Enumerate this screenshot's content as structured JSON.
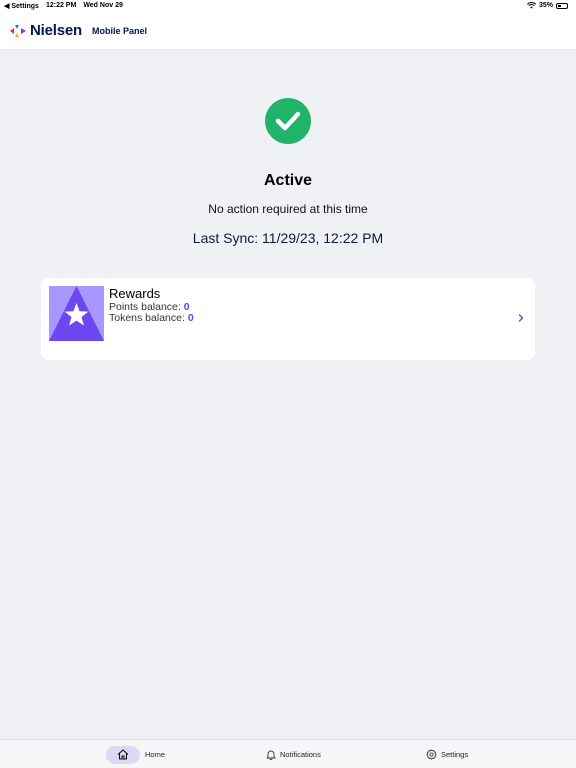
{
  "status_bar": {
    "back_app": "◀ Settings",
    "time": "12:22 PM",
    "date": "Wed Nov 29",
    "battery": "35%",
    "battery_level": 0.35
  },
  "header": {
    "brand": "Nielsen",
    "title": "Mobile Panel"
  },
  "status": {
    "icon": "checkmark-icon",
    "title": "Active",
    "description": "No action required at this time",
    "last_sync": "Last Sync: 11/29/23, 12:22 PM",
    "color": "#20b36a"
  },
  "rewards": {
    "title": "Rewards",
    "points_label": "Points balance:",
    "points_value": "0",
    "tokens_label": "Tokens balance:",
    "tokens_value": "0",
    "accent": "#6b3cf0"
  },
  "tabs": [
    {
      "label": "Home",
      "icon": "home-icon",
      "active": true
    },
    {
      "label": "Notifications",
      "icon": "bell-icon",
      "active": false
    },
    {
      "label": "Settings",
      "icon": "gear-icon",
      "active": false
    }
  ]
}
